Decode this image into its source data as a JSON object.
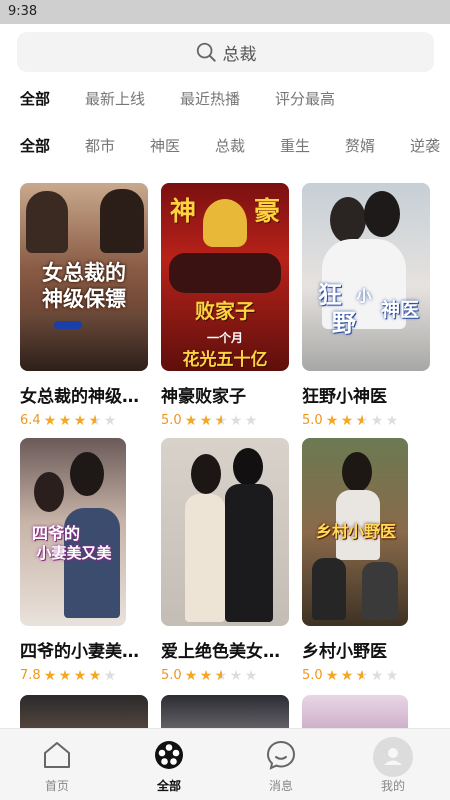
{
  "status": {
    "time": "9:38"
  },
  "search": {
    "placeholder": "总裁"
  },
  "sort_filters": [
    "全部",
    "最新上线",
    "最近热播",
    "评分最高"
  ],
  "category_filters": [
    "全部",
    "都市",
    "神医",
    "总裁",
    "重生",
    "赘婿",
    "逆袭"
  ],
  "colors": {
    "accent": "#f5a623",
    "score": "#f0961e"
  },
  "dramas": [
    {
      "title": "女总裁的神级保镖",
      "score": "6.4",
      "rating": 3.5,
      "poster_text": [
        "女总裁的",
        "神级保镖"
      ]
    },
    {
      "title": "神豪败家子",
      "score": "5.0",
      "rating": 2.5,
      "poster_text": [
        "神",
        "豪",
        "败家子",
        "一个月",
        "花光五十亿"
      ]
    },
    {
      "title": "狂野小神医",
      "score": "5.0",
      "rating": 2.5,
      "poster_text": [
        "狂",
        "野",
        "小",
        "神医"
      ]
    },
    {
      "title": "四爷的小妻美又飒",
      "score": "7.8",
      "rating": 4,
      "poster_text": [
        "四爷的",
        "小妻美又美"
      ]
    },
    {
      "title": "爱上绝色美女总裁",
      "score": "5.0",
      "rating": 2.5,
      "poster_text": []
    },
    {
      "title": "乡村小野医",
      "score": "5.0",
      "rating": 2.5,
      "poster_text": [
        "乡村小野医"
      ]
    }
  ],
  "tabs": [
    {
      "label": "首页",
      "icon": "home-icon"
    },
    {
      "label": "全部",
      "icon": "film-reel-icon"
    },
    {
      "label": "消息",
      "icon": "message-icon"
    },
    {
      "label": "我的",
      "icon": "avatar-icon"
    }
  ]
}
